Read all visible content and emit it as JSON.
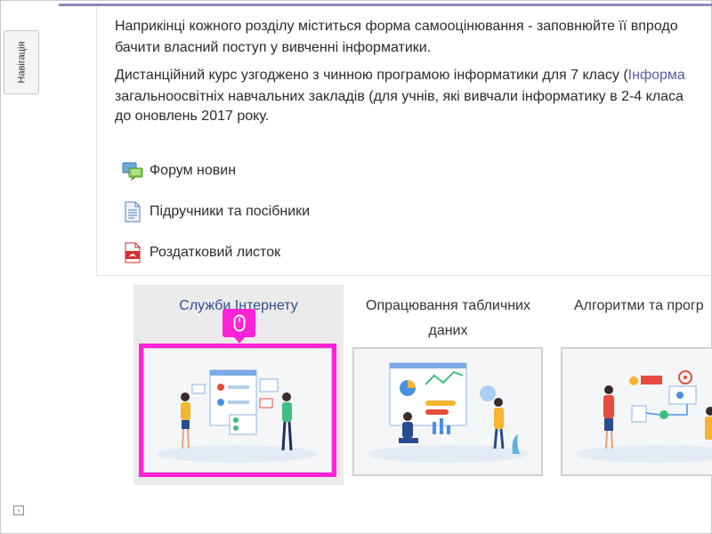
{
  "navigation": {
    "label": "Навігація"
  },
  "description": {
    "p1_line1": "Наприкінці кожного розділу міститься форма самооцінювання - заповнюйте її впродо",
    "p1_line2": "бачити власний поступ у вивченні інформатики.",
    "p2_line1_a": "Дистанційний курс узгоджено з чинною програмою інформатики для 7 класу (",
    "p2_line1_link": "Інформа",
    "p2_line2": "загальноосвітніх навчальних закладів (для учнів, які вивчали інформатику в 2-4 класа",
    "p2_line3": "до оновлень 2017 року."
  },
  "resources": [
    {
      "label": "Форум новин",
      "icon": "forum-icon"
    },
    {
      "label": "Підручники та посібники",
      "icon": "document-icon"
    },
    {
      "label": "Роздатковий листок",
      "icon": "pdf-icon"
    }
  ],
  "tiles": [
    {
      "title": "Служби Інтернету"
    },
    {
      "title_line1": "Опрацювання табличних",
      "title_line2": "даних"
    },
    {
      "title": "Алгоритми та прогр"
    }
  ],
  "colors": {
    "highlight": "#ff22d6",
    "link": "#5b5ba8",
    "tile_title_active": "#2f4f8f"
  }
}
